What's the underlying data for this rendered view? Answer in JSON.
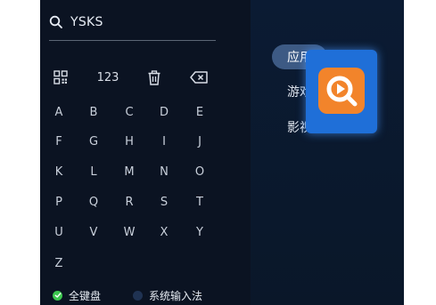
{
  "search": {
    "query": "YSKS",
    "icon": "search-icon"
  },
  "function_keys": {
    "qr_icon": "qr-code-icon",
    "numeric_label": "123",
    "delete_icon": "trash-icon",
    "backspace_icon": "backspace-icon"
  },
  "keys": {
    "row1": [
      "A",
      "B",
      "C",
      "D",
      "E"
    ],
    "row2": [
      "F",
      "G",
      "H",
      "I",
      "J"
    ],
    "row3": [
      "K",
      "L",
      "M",
      "N",
      "O"
    ],
    "row4": [
      "P",
      "Q",
      "R",
      "S",
      "T"
    ],
    "row5": [
      "U",
      "V",
      "W",
      "X",
      "Y"
    ],
    "row6": [
      "Z"
    ]
  },
  "footer": {
    "full_keyboard": {
      "label": "全键盘",
      "selected": true
    },
    "system_ime": {
      "label": "系统输入法",
      "selected": false
    }
  },
  "categories": [
    {
      "label": "应用",
      "active": true
    },
    {
      "label": "游戏",
      "active": false
    },
    {
      "label": "影视",
      "active": false
    }
  ],
  "app_card": {
    "icon": "play-search-app-icon"
  },
  "colors": {
    "panel_bg": "#0b1322",
    "category_bg": "#0b1b33",
    "active_pill": "#3d5a84",
    "card_highlight": "#1f6fd8",
    "app_icon_bg": "#f2842b",
    "selected_radio": "#3cc64f"
  }
}
